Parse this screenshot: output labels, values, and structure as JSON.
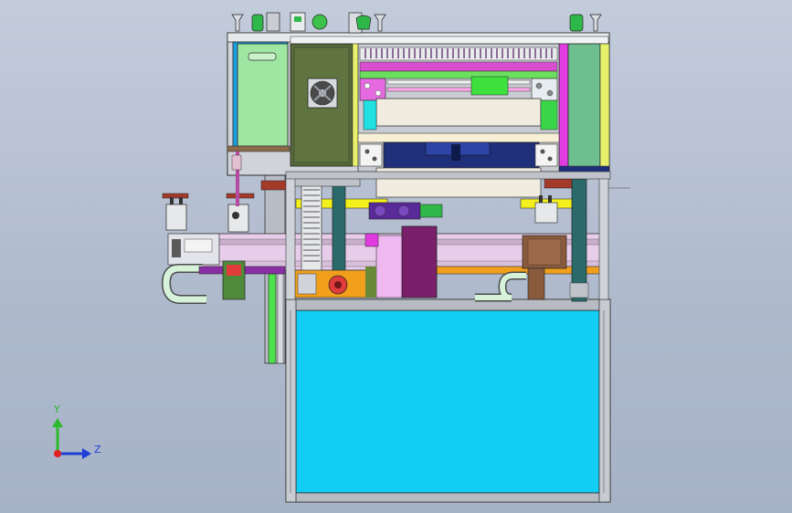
{
  "viewport": {
    "background_top": "#c3ccdb",
    "background_bottom": "#a6b2c6"
  },
  "triad": {
    "y_label": "Y",
    "z_label": "Z",
    "y_color": "#2db82d",
    "z_color": "#1f3fd6",
    "x_color": "#e01f1f"
  },
  "colors": {
    "cabinet_blue": "#12cdf4",
    "frame_gray": "#8c8f96",
    "panel_green": "#8fd692",
    "dark_olive": "#5c6b3c",
    "magenta": "#e03ce0",
    "purple": "#7a1f7a",
    "orange": "#f29a1c",
    "brown": "#8a5a3c",
    "yellow": "#f4f01c",
    "navy": "#1f2f7a"
  }
}
